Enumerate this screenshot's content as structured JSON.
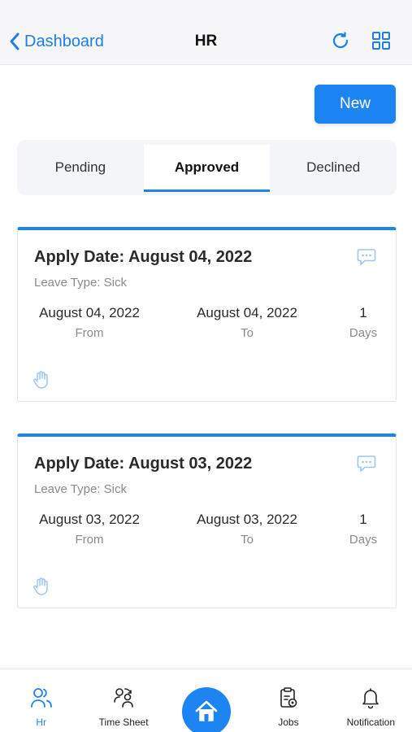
{
  "nav": {
    "back_label": "Dashboard",
    "title": "HR"
  },
  "new_button": "New",
  "tabs": [
    {
      "label": "Pending"
    },
    {
      "label": "Approved"
    },
    {
      "label": "Declined"
    }
  ],
  "active_tab": "Approved",
  "cards": [
    {
      "title": "Apply Date: August 04, 2022",
      "leave_type": "Leave Type: Sick",
      "from_value": "August 04, 2022",
      "from_label": "From",
      "to_value": "August 04, 2022",
      "to_label": "To",
      "days_value": "1",
      "days_label": "Days"
    },
    {
      "title": "Apply Date: August 03, 2022",
      "leave_type": "Leave Type: Sick",
      "from_value": "August 03, 2022",
      "from_label": "From",
      "to_value": "August 03, 2022",
      "to_label": "To",
      "days_value": "1",
      "days_label": "Days"
    }
  ],
  "tabbar": [
    {
      "label": "Hr",
      "icon": "people-icon"
    },
    {
      "label": "Time Sheet",
      "icon": "timesheet-icon"
    },
    {
      "label": "",
      "icon": "home-icon"
    },
    {
      "label": "Jobs",
      "icon": "clipboard-icon"
    },
    {
      "label": "Notification",
      "icon": "bell-icon"
    }
  ],
  "colors": {
    "accent": "#1c84f3",
    "nav_blue": "#1c7fe8",
    "light_icon": "#9cc7f0"
  }
}
